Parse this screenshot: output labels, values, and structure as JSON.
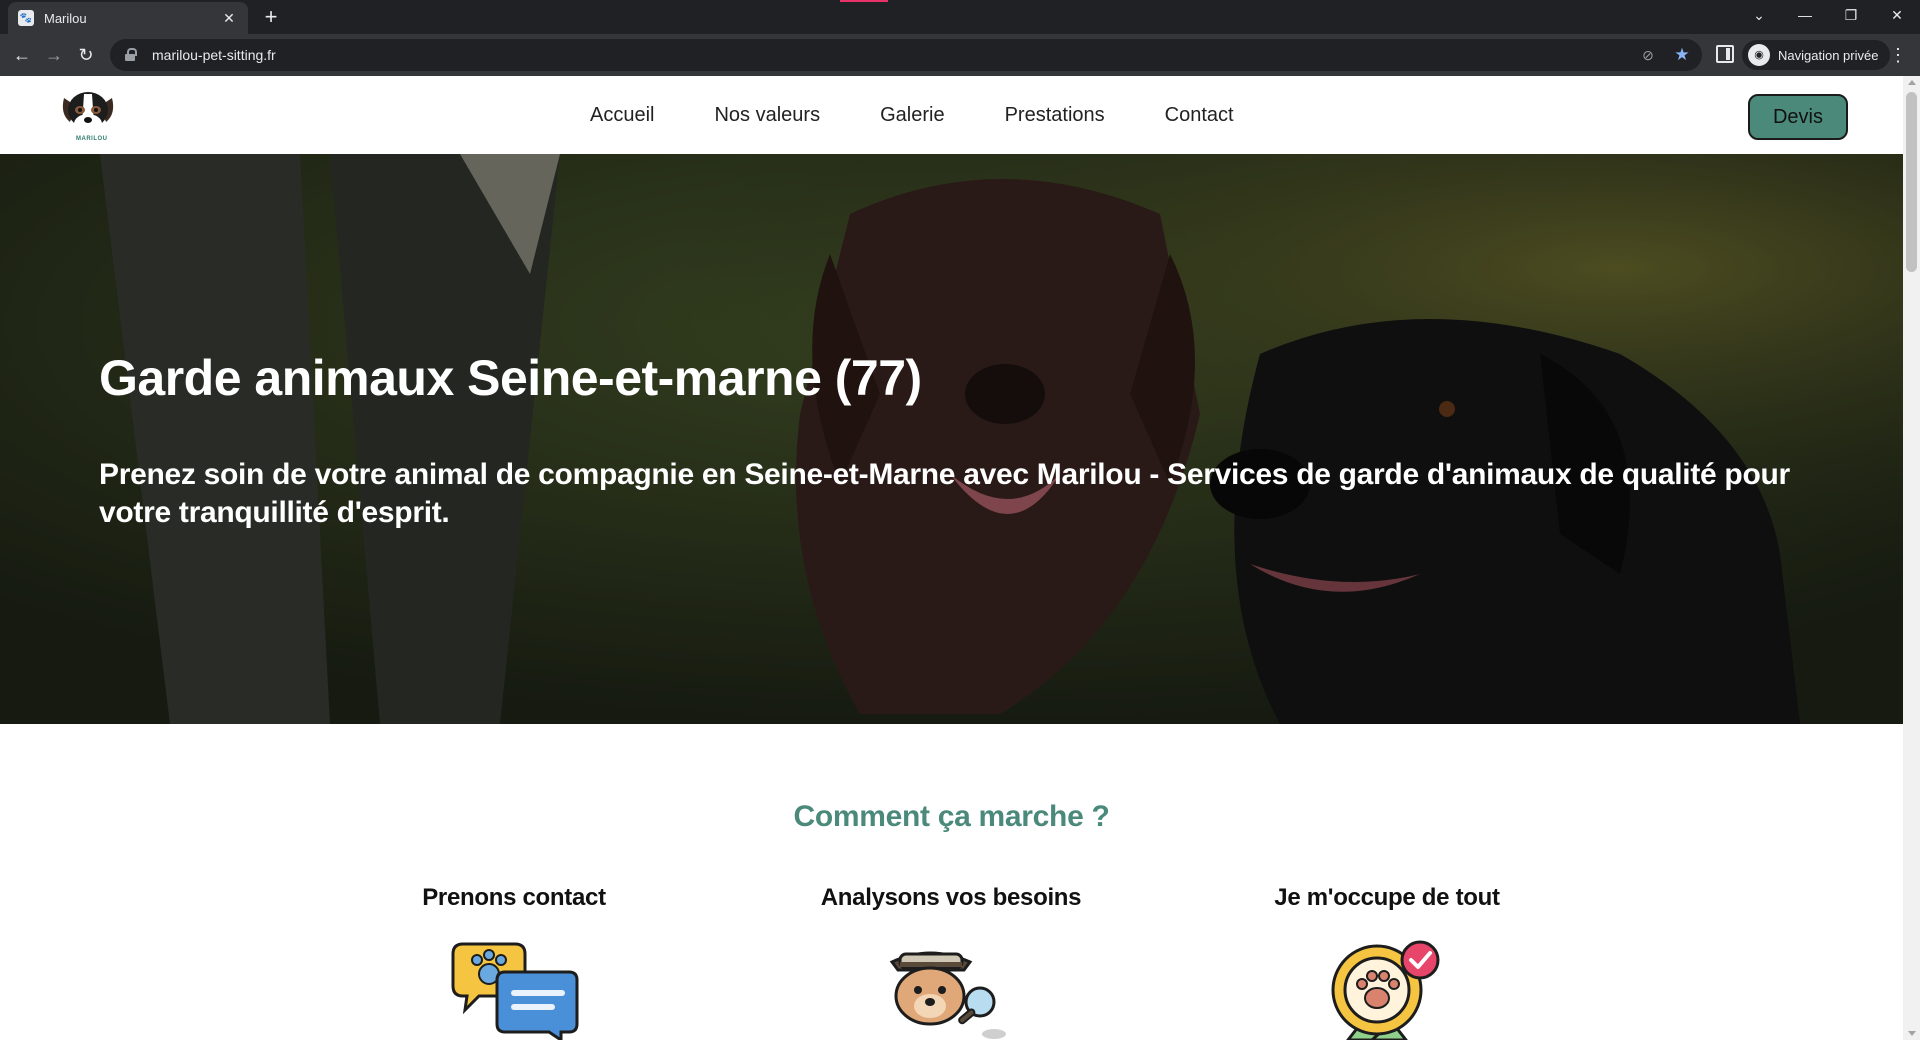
{
  "browser": {
    "tab_title": "Marilou",
    "url": "marilou-pet-sitting.fr",
    "incognito_label": "Navigation privée",
    "icons": [
      "back-icon",
      "forward-icon",
      "reload-icon",
      "lock-icon",
      "eye-off-icon",
      "star-icon",
      "side-panel-icon",
      "incognito-icon",
      "menu-icon"
    ]
  },
  "site": {
    "logo_text": "MARILOU",
    "nav": [
      "Accueil",
      "Nos valeurs",
      "Galerie",
      "Prestations",
      "Contact"
    ],
    "cta_label": "Devis",
    "accent_color": "#4b8a7b"
  },
  "hero": {
    "title": "Garde animaux Seine-et-marne (77)",
    "subtitle": "Prenez soin de votre animal de compagnie en Seine-et-Marne avec Marilou - Services de garde d'animaux de qualité pour votre tranquillité d'esprit."
  },
  "how": {
    "title": "Comment ça marche ?",
    "steps": [
      {
        "title": "Prenons contact",
        "icon": "chat-paw-icon"
      },
      {
        "title": "Analysons vos besoins",
        "icon": "detective-dog-icon"
      },
      {
        "title": "Je m'occupe de tout",
        "icon": "paw-badge-icon"
      }
    ]
  }
}
